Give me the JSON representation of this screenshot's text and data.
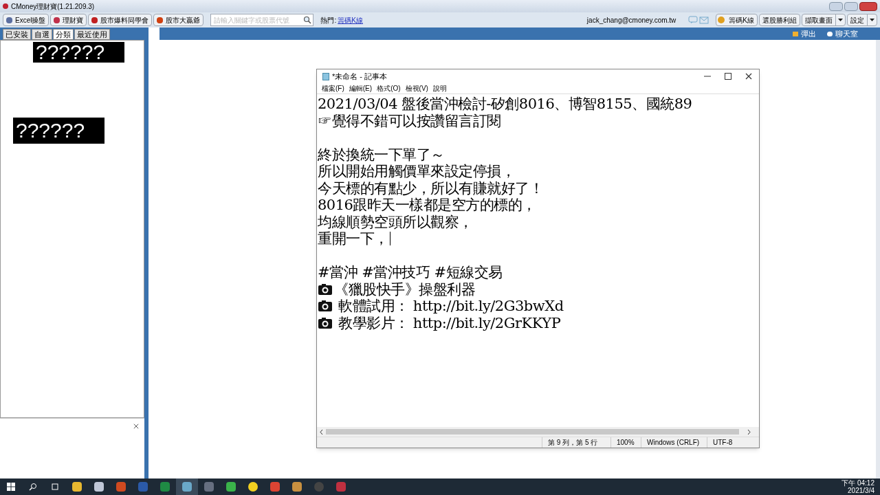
{
  "app": {
    "title": "CMoney理財寶(1.21.209.3)",
    "toolbar": [
      "Excel操盤",
      "理財寶",
      "股市爆料同學會",
      "股市大贏爺"
    ],
    "search": {
      "placeholder": "請輸入關鍵字或股票代號"
    },
    "hot": {
      "label": "熱門:",
      "link": "籌碼K線"
    },
    "user": "jack_chang@cmoney.com.tw",
    "right_buttons": [
      {
        "label": "籌碼K線",
        "kind": "icon"
      },
      {
        "label": "選股勝利組",
        "kind": "plain"
      },
      {
        "label": "擷取畫面",
        "kind": "dropdown"
      },
      {
        "label": "設定",
        "kind": "dropdown"
      }
    ],
    "tabs": [
      {
        "label": "已安裝",
        "selected": false
      },
      {
        "label": "自選",
        "selected": false
      },
      {
        "label": "分類",
        "selected": true
      },
      {
        "label": "最近使用",
        "selected": false
      }
    ],
    "overlays": [
      "??????",
      "??????"
    ],
    "bar_actions": [
      "彈出",
      "聊天室"
    ]
  },
  "notepad": {
    "title": "*未命名 - 記事本",
    "menu": [
      "檔案(F)",
      "編輯(E)",
      "格式(O)",
      "檢視(V)",
      "說明"
    ],
    "lines": [
      {
        "kind": "text",
        "text": "2021/03/04 盤後當沖檢討-矽創8016、博智8155、國統89"
      },
      {
        "kind": "text",
        "text": "☞覺得不錯可以按讚留言訂閱"
      },
      {
        "kind": "blank"
      },
      {
        "kind": "text",
        "text": "終於換統一下單了～"
      },
      {
        "kind": "text",
        "text": "所以開始用觸價單來設定停損，"
      },
      {
        "kind": "text",
        "text": "今天標的有點少，所以有賺就好了！"
      },
      {
        "kind": "text",
        "text": "8016跟昨天一樣都是空方的標的，"
      },
      {
        "kind": "text",
        "text": "均線順勢空頭所以觀察，"
      },
      {
        "kind": "text",
        "text": "重開一下，",
        "cursor": true
      },
      {
        "kind": "blank"
      },
      {
        "kind": "text",
        "text": "#當沖 #當沖技巧 #短線交易"
      },
      {
        "kind": "text",
        "text": "《獵股快手》操盤利器",
        "camera": true
      },
      {
        "kind": "text",
        "text": " 軟體試用： http://bit.ly/2G3bwXd",
        "camera": true
      },
      {
        "kind": "text",
        "text": " 教學影片： http://bit.ly/2GrKKYP",
        "camera": true
      }
    ],
    "status": [
      "第 9 列，第 5 行",
      "100%",
      "Windows (CRLF)",
      "UTF-8"
    ]
  },
  "taskbar": {
    "time": "下午 04:12",
    "date": "2021/3/4"
  }
}
